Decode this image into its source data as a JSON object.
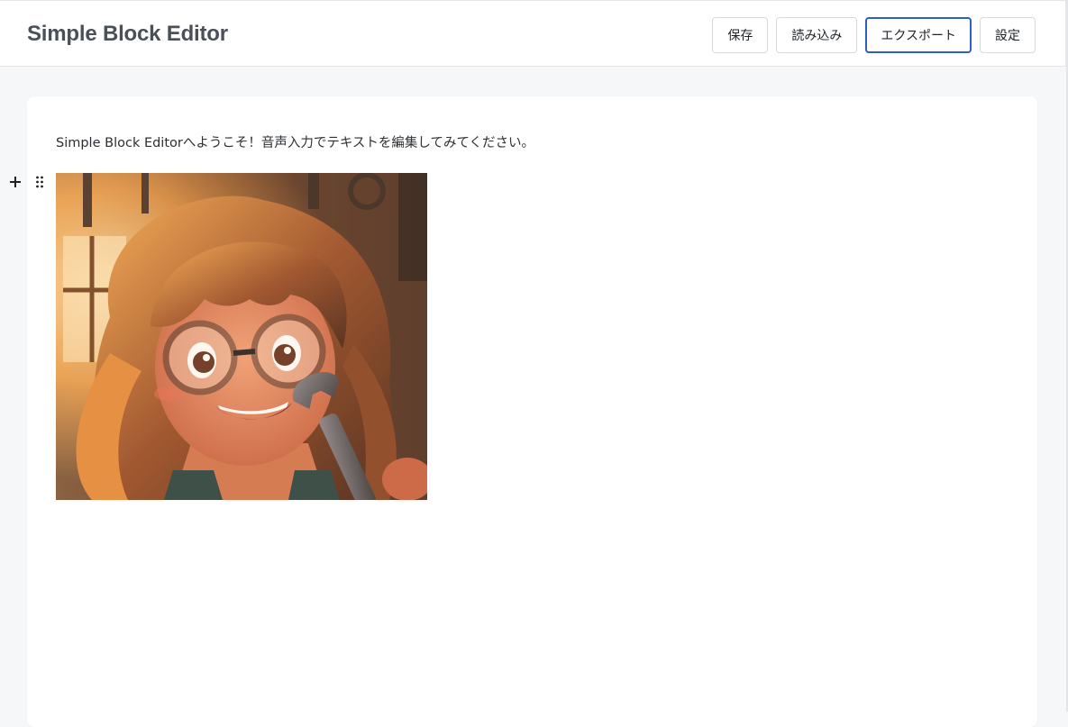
{
  "app": {
    "title": "Simple Block Editor"
  },
  "toolbar": {
    "buttons": [
      {
        "label": "保存",
        "focused": false
      },
      {
        "label": "読み込み",
        "focused": false
      },
      {
        "label": "エクスポート",
        "focused": true
      },
      {
        "label": "設定",
        "focused": false
      }
    ]
  },
  "editor": {
    "blocks": [
      {
        "type": "paragraph",
        "text": "Simple Block Editorへようこそ！音声入力でテキストを編集してみてください。"
      },
      {
        "type": "image",
        "content": "anime-girl-with-glasses-and-wrench"
      }
    ],
    "block_controls": {
      "add_icon": "plus-icon",
      "drag_icon": "drag-handle-icon"
    }
  },
  "colors": {
    "focus_border": "#2d5fc4",
    "page_background": "#f6f7f9",
    "title_text": "#4a5058"
  }
}
